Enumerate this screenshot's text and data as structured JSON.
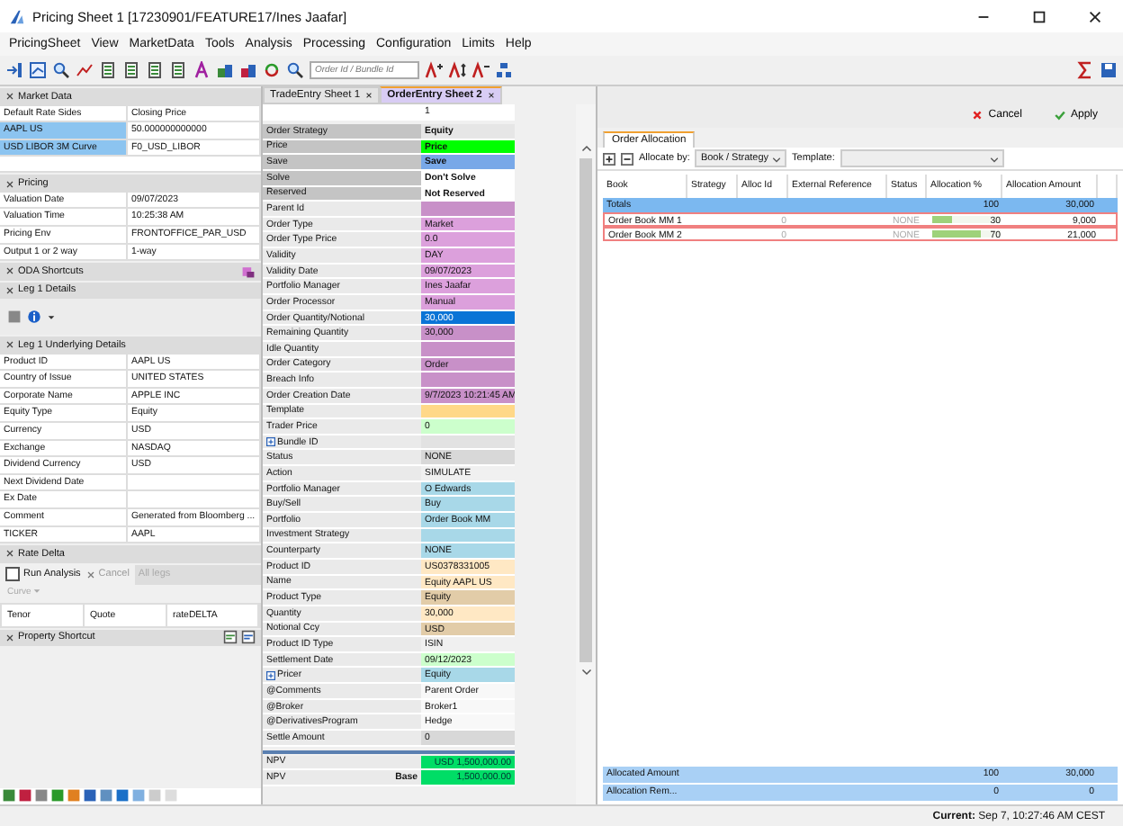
{
  "window": {
    "title": "Pricing Sheet 1 [17230901/FEATURE17/Ines Jaafar]"
  },
  "menu": [
    "PricingSheet",
    "View",
    "MarketData",
    "Tools",
    "Analysis",
    "Processing",
    "Configuration",
    "Limits",
    "Help"
  ],
  "toolbar": {
    "search": {
      "placeholder": "Order Id / Bundle Id"
    }
  },
  "left_panel": {
    "sections": [
      {
        "title": "Market Data",
        "kind": "table",
        "rows": [
          {
            "label": "Default Rate Sides",
            "value": "Closing Price",
            "selected": false
          },
          {
            "label": "AAPL US",
            "value": "50.000000000000",
            "selected": true
          },
          {
            "label": "USD LIBOR 3M Curve",
            "value": "F0_USD_LIBOR",
            "selected": true
          }
        ]
      },
      {
        "title": "Pricing",
        "kind": "table",
        "rows": [
          {
            "label": "Valuation Date",
            "value": "09/07/2023",
            "selected": false
          },
          {
            "label": "Valuation Time",
            "value": "10:25:38 AM",
            "selected": false
          },
          {
            "label": "Pricing Env",
            "value": "FRONTOFFICE_PAR_USD",
            "selected": false
          },
          {
            "label": "Output 1 or 2 way",
            "value": "1-way",
            "selected": false
          }
        ]
      },
      {
        "title": "ODA Shortcuts",
        "kind": "shortcuts"
      },
      {
        "title": "Leg 1 Details",
        "kind": "details"
      },
      {
        "title": "Leg 1 Underlying Details",
        "kind": "table",
        "rows": [
          {
            "label": "Product ID",
            "value": "AAPL US",
            "selected": false
          },
          {
            "label": "Country of Issue",
            "value": "UNITED STATES",
            "selected": false
          },
          {
            "label": "Corporate Name",
            "value": "APPLE INC",
            "selected": false
          },
          {
            "label": "Equity Type",
            "value": "Equity",
            "selected": false
          },
          {
            "label": "Currency",
            "value": "USD",
            "selected": false
          },
          {
            "label": "Exchange",
            "value": "NASDAQ",
            "selected": false
          },
          {
            "label": "Dividend Currency",
            "value": "USD",
            "selected": false
          },
          {
            "label": "Next Dividend Date",
            "value": "",
            "selected": false
          },
          {
            "label": "Ex Date",
            "value": "",
            "selected": false
          },
          {
            "label": "Comment",
            "value": "Generated from Bloomberg ...",
            "selected": false
          },
          {
            "label": "TICKER",
            "value": "AAPL",
            "selected": false
          }
        ]
      },
      {
        "title": "Rate Delta",
        "kind": "rate_delta",
        "run_analysis": {
          "label": "Run Analysis",
          "checked": false
        },
        "cancel": {
          "label": "Cancel",
          "disabled": true
        },
        "legs": "All legs",
        "curve": "Curve",
        "columns": [
          "Tenor",
          "Quote",
          "rateDELTA"
        ]
      },
      {
        "title": "Property Shortcut",
        "kind": "property"
      }
    ]
  },
  "sheet_tabs": [
    {
      "label": "TradeEntry Sheet 1",
      "selected": false
    },
    {
      "label": "OrderEntry Sheet 2",
      "selected": true
    }
  ],
  "order_sheet": {
    "index_value": "1",
    "rows": [
      {
        "label": "Order Strategy",
        "value": "Equity",
        "kind": "setting",
        "color": "#e6e6e6"
      },
      {
        "label": "Price",
        "value": "Price",
        "kind": "setting",
        "color": "#00ff00"
      },
      {
        "label": "Save",
        "value": "Save",
        "kind": "setting",
        "color": "#78a8e8"
      },
      {
        "label": "Solve",
        "value": "Don't Solve",
        "kind": "setting",
        "color": "#ffffff"
      },
      {
        "label": "Reserved",
        "value": "Not Reserved",
        "kind": "setting",
        "color": "#ffffff"
      },
      {
        "label": "Parent Id",
        "value": "",
        "kind": "field",
        "color": "#c890c8"
      },
      {
        "label": "Order Type",
        "value": "Market",
        "kind": "field",
        "color": "#dca0dc"
      },
      {
        "label": "Order Type Price",
        "value": "0.0",
        "kind": "field",
        "color": "#dca0dc"
      },
      {
        "label": "Validity",
        "value": "DAY",
        "kind": "field",
        "color": "#dca0dc"
      },
      {
        "label": "Validity Date",
        "value": "09/07/2023",
        "kind": "field",
        "color": "#dca0dc"
      },
      {
        "label": "Portfolio Manager",
        "value": "Ines Jaafar",
        "kind": "field",
        "color": "#dca0dc"
      },
      {
        "label": "Order Processor",
        "value": "Manual",
        "kind": "field",
        "color": "#dca0dc"
      },
      {
        "label": "Order Quantity/Notional",
        "value": "30,000",
        "kind": "field",
        "color": "#0a74d6"
      },
      {
        "label": "Remaining Quantity",
        "value": "30,000",
        "kind": "field",
        "color": "#c890c8"
      },
      {
        "label": "Idle Quantity",
        "value": "",
        "kind": "field",
        "color": "#c890c8"
      },
      {
        "label": "Order Category",
        "value": "Order",
        "kind": "field",
        "color": "#c890c8"
      },
      {
        "label": "Breach Info",
        "value": "",
        "kind": "field",
        "color": "#c890c8"
      },
      {
        "label": "Order Creation Date",
        "value": "9/7/2023 10:21:45 AM",
        "kind": "field",
        "color": "#c890c8"
      },
      {
        "label": "Template",
        "value": "",
        "kind": "field",
        "color": "#ffd888"
      },
      {
        "label": "Trader Price",
        "value": "0",
        "kind": "field",
        "color": "#ccffcc"
      },
      {
        "label": "Bundle ID",
        "value": "",
        "kind": "group",
        "color": "#e2e2e2"
      },
      {
        "label": "Status",
        "value": "NONE",
        "kind": "field",
        "color": "#d8d8d8"
      },
      {
        "label": "Action",
        "value": "SIMULATE",
        "kind": "field",
        "color": "#f0f0f0"
      },
      {
        "label": "Portfolio Manager",
        "value": "O Edwards",
        "kind": "field",
        "color": "#a8d8e8"
      },
      {
        "label": "Buy/Sell",
        "value": "Buy",
        "kind": "field",
        "color": "#a8d8e8"
      },
      {
        "label": "Portfolio",
        "value": "Order Book MM",
        "kind": "field",
        "color": "#a8d8e8"
      },
      {
        "label": "Investment Strategy",
        "value": "",
        "kind": "field",
        "color": "#a8d8e8"
      },
      {
        "label": "Counterparty",
        "value": "NONE",
        "kind": "field",
        "color": "#a8d8e8"
      },
      {
        "label": "Product ID",
        "value": "US0378331005",
        "kind": "field",
        "color": "#ffe8c4"
      },
      {
        "label": "Name",
        "value": "Equity AAPL US",
        "kind": "field",
        "color": "#ffe8c4"
      },
      {
        "label": "Product Type",
        "value": "Equity",
        "kind": "field",
        "color": "#e2cca8"
      },
      {
        "label": "Quantity",
        "value": "30,000",
        "kind": "field",
        "color": "#ffe8c4"
      },
      {
        "label": "Notional Ccy",
        "value": "USD",
        "kind": "field",
        "color": "#e2cca8"
      },
      {
        "label": "Product ID Type",
        "value": "ISIN",
        "kind": "field",
        "color": "#f0f0f0"
      },
      {
        "label": "Settlement Date",
        "value": "09/12/2023",
        "kind": "field",
        "color": "#ccffcc"
      },
      {
        "label": "Pricer",
        "value": "Equity",
        "kind": "group",
        "color": "#a8d8e8"
      },
      {
        "label": "@Comments",
        "value": "Parent Order",
        "kind": "field",
        "color": "#f8f8f8"
      },
      {
        "label": "@Broker",
        "value": "Broker1",
        "kind": "field",
        "color": "#f8f8f8"
      },
      {
        "label": "@DerivativesProgram",
        "value": "Hedge",
        "kind": "field",
        "color": "#f8f8f8"
      },
      {
        "label": "Settle Amount",
        "value": "0",
        "kind": "field",
        "color": "#d8d8d8"
      }
    ],
    "results": [
      {
        "label": "NPV",
        "value": "USD   1,500,000.00"
      },
      {
        "label": "NPV",
        "sub": "Base",
        "value": "1,500,000.00"
      }
    ]
  },
  "actions": [
    {
      "label": "Cancel",
      "kind": "cancel"
    },
    {
      "label": "Apply",
      "kind": "apply"
    }
  ],
  "allocation": {
    "tab": "Order Allocation",
    "allocate_by": {
      "label": "Allocate by:",
      "value": "Book / Strategy"
    },
    "template": {
      "label": "Template:"
    },
    "columns": [
      "Book",
      "Strategy",
      "Alloc Id",
      "External Reference",
      "Status",
      "Allocation %",
      "Allocation Amount"
    ],
    "rows": [
      {
        "kind": "total",
        "book": "Totals",
        "status": "",
        "percent": "100",
        "amount": "30,000"
      },
      {
        "kind": "allocation",
        "book": "Order Book MM 1",
        "alloc_id": "0",
        "status": "NONE",
        "percent": "30",
        "level": 0.3,
        "amount": "9,000"
      },
      {
        "kind": "allocation",
        "book": "Order Book MM 2",
        "alloc_id": "0",
        "status": "NONE",
        "percent": "70",
        "level": 0.7,
        "amount": "21,000"
      }
    ],
    "summary": [
      {
        "label": "Allocated Amount",
        "percent": "100",
        "amount": "30,000"
      },
      {
        "label": "Allocation Rem...",
        "percent": "0",
        "amount": "0"
      }
    ]
  },
  "status_bar": {
    "label": "Current:",
    "value": "Sep 7, 10:27:46 AM CEST"
  }
}
